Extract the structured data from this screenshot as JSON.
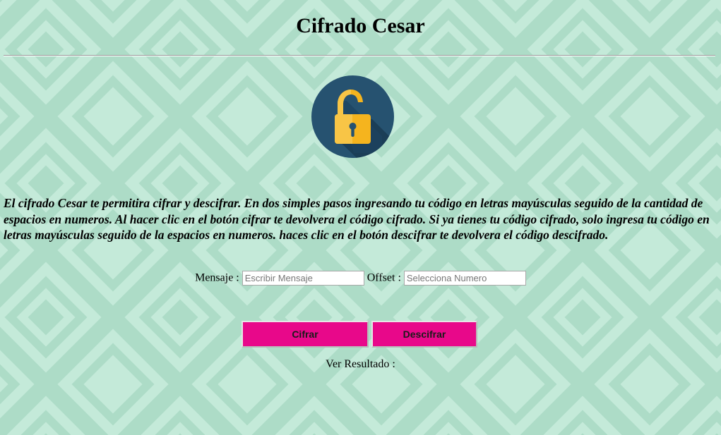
{
  "header": {
    "title": "Cifrado Cesar"
  },
  "logo": {
    "icon": "open-padlock-icon"
  },
  "description": "El cifrado Cesar te permitira cifrar y descifrar. En dos simples pasos ingresando tu código en letras mayúsculas seguido de la cantidad de espacios en numeros. Al hacer clic en el botón cifrar te devolvera el código cifrado. Si ya tienes tu código cifrado, solo ingresa tu código en letras mayúsculas seguido de la espacios en numeros. haces clic en el botón descifrar te devolvera el código descifrado.",
  "form": {
    "message_label": "Mensaje :",
    "message_placeholder": "Escribir Mensaje",
    "message_value": "",
    "offset_label": "Offset :",
    "offset_placeholder": "Selecciona Numero",
    "offset_value": ""
  },
  "buttons": {
    "encrypt": "Cifrar",
    "decrypt": "Descifrar"
  },
  "result": {
    "label": "Ver Resultado :",
    "value": ""
  },
  "colors": {
    "background": "#c4ead9",
    "pattern": "#acdcc7",
    "button": "#e8088a",
    "lock_circle": "#265270",
    "lock_body": "#f5b41e"
  }
}
